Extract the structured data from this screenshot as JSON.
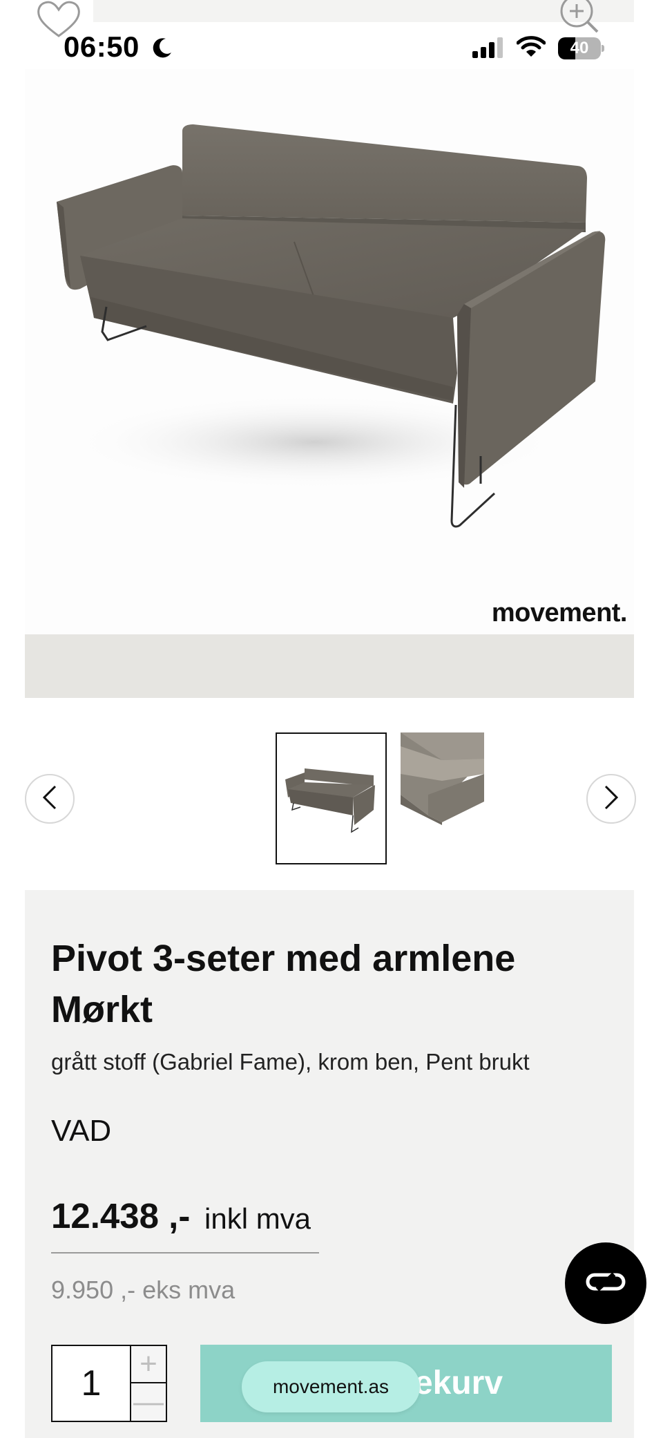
{
  "status_bar": {
    "time": "06:50",
    "battery": "40",
    "battery_level": 0.4
  },
  "top_icons": {
    "favorite_icon": "heart-outline-icon",
    "zoom_icon": "zoom-in-icon"
  },
  "gallery": {
    "watermark": "movement.",
    "thumbnails": [
      {
        "name": "sofa-front-view",
        "selected": true
      },
      {
        "name": "sofa-armrest-detail",
        "selected": false
      }
    ],
    "prev_icon": "chevron-left-icon",
    "next_icon": "chevron-right-icon"
  },
  "product": {
    "title": "Pivot 3-seter med armlene Mørkt",
    "subtitle": "grått stoff (Gabriel Fame), krom ben, Pent brukt",
    "brand": "VAD",
    "price_incl": "12.438 ,-",
    "price_incl_suffix": "inkl mva",
    "price_excl": "9.950 ,- eks mva"
  },
  "purchase": {
    "quantity": "1",
    "plus": "+",
    "minus": "—",
    "cart_label": "ndlekurv"
  },
  "browser": {
    "url": "movement.as"
  },
  "chat": {
    "icon": "chat-link-icon"
  },
  "colors": {
    "accent": "#8dd3c7",
    "panel": "#f2f2f1",
    "sofa": "#6f6a62"
  }
}
